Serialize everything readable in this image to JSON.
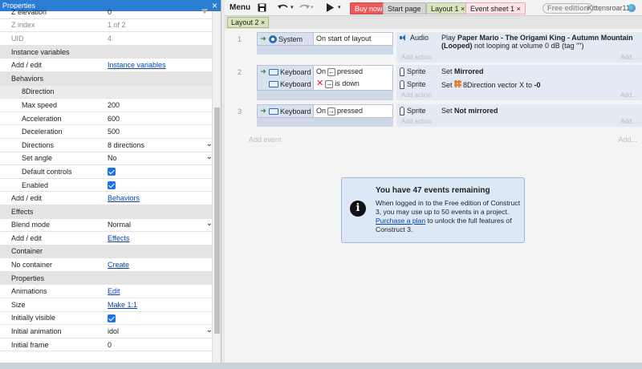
{
  "props": {
    "title": "Properties",
    "rows": [
      {
        "kind": "row",
        "k": "Z elevation",
        "v": "0"
      },
      {
        "kind": "row",
        "k": "Z index",
        "v": "1 of 2",
        "dim": true
      },
      {
        "kind": "row",
        "k": "UID",
        "v": "4",
        "dim": true
      },
      {
        "kind": "sec",
        "k": "Instance variables"
      },
      {
        "kind": "row",
        "k": "Add / edit",
        "link": "Instance variables"
      },
      {
        "kind": "sec",
        "k": "Behaviors"
      },
      {
        "kind": "subsec",
        "k": "8Direction"
      },
      {
        "kind": "row",
        "sub": true,
        "k": "Max speed",
        "v": "200"
      },
      {
        "kind": "row",
        "sub": true,
        "k": "Acceleration",
        "v": "600"
      },
      {
        "kind": "row",
        "sub": true,
        "k": "Deceleration",
        "v": "500"
      },
      {
        "kind": "row",
        "sub": true,
        "k": "Directions",
        "v": "8 directions",
        "select": true
      },
      {
        "kind": "row",
        "sub": true,
        "k": "Set angle",
        "v": "No",
        "select": true
      },
      {
        "kind": "row",
        "sub": true,
        "k": "Default controls",
        "check": true
      },
      {
        "kind": "row",
        "sub": true,
        "k": "Enabled",
        "check": true
      },
      {
        "kind": "row",
        "k": "Add / edit",
        "link": "Behaviors"
      },
      {
        "kind": "sec",
        "k": "Effects"
      },
      {
        "kind": "row",
        "k": "Blend mode",
        "v": "Normal",
        "select": true
      },
      {
        "kind": "row",
        "k": "Add / edit",
        "link": "Effects"
      },
      {
        "kind": "sec",
        "k": "Container"
      },
      {
        "kind": "row",
        "k": "No container",
        "link": "Create"
      },
      {
        "kind": "sec",
        "k": "Properties"
      },
      {
        "kind": "row",
        "k": "Animations",
        "link": "Edit"
      },
      {
        "kind": "row",
        "k": "Size",
        "link": "Make 1:1"
      },
      {
        "kind": "row",
        "k": "Initially visible",
        "check": true
      },
      {
        "kind": "row",
        "k": "Initial animation",
        "v": "idol",
        "select": true
      },
      {
        "kind": "row",
        "k": "Initial frame",
        "v": "0"
      }
    ]
  },
  "toolbar": {
    "menu": "Menu",
    "buy_now": "Buy now",
    "tab_start": "Start page",
    "tab_layout": "Layout 1",
    "tab_events": "Event sheet 1",
    "edition": "Free edition",
    "user": "Kittensroar11",
    "close_glyph": "×"
  },
  "subtab": "Layout 2",
  "events": [
    {
      "num": "1",
      "conds": [
        {
          "obj": "System",
          "icon": "gear",
          "text": "On start of layout"
        }
      ],
      "actions": [
        {
          "obj": "Audio",
          "icon": "audio",
          "text_pre": "Play ",
          "bold": "Paper Mario - The Origami King - Autumn Mountain (Looped)",
          "text_post": " not looping at volume 0 dB (tag \"\")"
        }
      ],
      "add_action": "Add action"
    },
    {
      "num": "2",
      "conds": [
        {
          "obj": "Keyboard",
          "icon": "keyboard",
          "pre": "On",
          "key": "←",
          "text": "pressed",
          "arrow": true
        },
        {
          "obj": "Keyboard",
          "icon": "keyboard",
          "invert": true,
          "key": "→",
          "text": "is down"
        }
      ],
      "actions": [
        {
          "obj": "Sprite",
          "icon": "sprite",
          "text_pre": "Set ",
          "bold": "Mirrored",
          "text_post": ""
        },
        {
          "obj": "Sprite",
          "icon": "sprite",
          "text_pre": "Set ",
          "vec": true,
          "mid": "8Direction vector X to ",
          "bold": "-0",
          "text_post": ""
        }
      ],
      "add_action": "Add action"
    },
    {
      "num": "3",
      "conds": [
        {
          "obj": "Keyboard",
          "icon": "keyboard",
          "pre": "On",
          "key": "→",
          "text": "pressed",
          "arrow": true
        }
      ],
      "actions": [
        {
          "obj": "Sprite",
          "icon": "sprite",
          "text_pre": "Set ",
          "bold": "Not mirrored",
          "text_post": ""
        }
      ],
      "add_action": "Add action"
    }
  ],
  "add_event": "Add event",
  "add_short": "Add...",
  "info": {
    "title": "You have 47 events remaining",
    "line1": "When logged in to the Free edition of Construct 3, you may use up to 50 events in a project. ",
    "link": "Purchase a plan",
    "line2": " to unlock the full features of Construct 3."
  }
}
